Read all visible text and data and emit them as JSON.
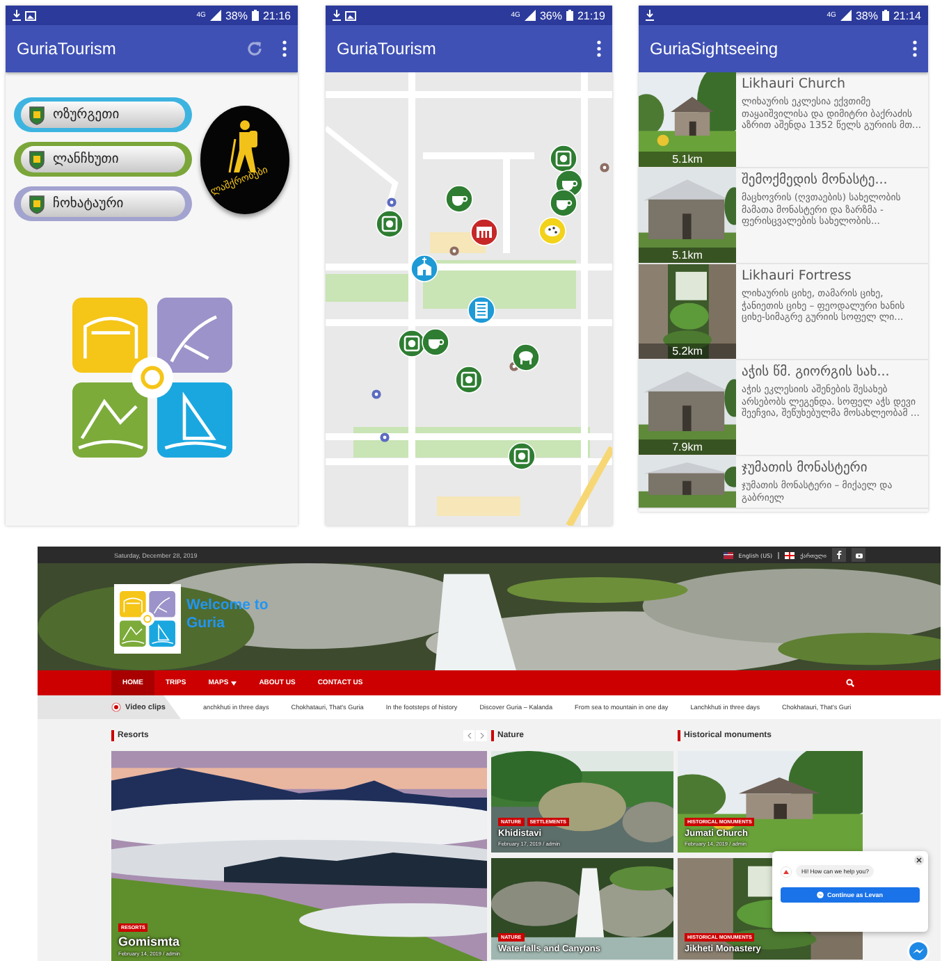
{
  "home_screen": {
    "status_bar": {
      "network": "4G",
      "battery": "38%",
      "time": "21:16"
    },
    "title": "GuriaTourism",
    "city_buttons": [
      {
        "label": "ოზურგეთი",
        "color": "#3db4e0"
      },
      {
        "label": "ლანჩხუთი",
        "color": "#7ba63a"
      },
      {
        "label": "ჩოხატაური",
        "color": "#a3a3d0"
      }
    ],
    "hiking_badge": {
      "label": "ლაშქრობები"
    }
  },
  "map_screen": {
    "status_bar": {
      "network": "4G",
      "battery": "36%",
      "time": "21:19"
    },
    "title": "GuriaTourism",
    "markers": [
      {
        "kind": "restaurant"
      },
      {
        "kind": "cafe"
      },
      {
        "kind": "cafe"
      },
      {
        "kind": "cafe"
      },
      {
        "kind": "restaurant"
      },
      {
        "kind": "theater"
      },
      {
        "kind": "art"
      },
      {
        "kind": "church"
      },
      {
        "kind": "bank"
      },
      {
        "kind": "restaurant"
      },
      {
        "kind": "cafe"
      },
      {
        "kind": "animal"
      },
      {
        "kind": "restaurant"
      },
      {
        "kind": "restaurant"
      }
    ]
  },
  "list_screen": {
    "status_bar": {
      "network": "4G",
      "battery": "38%",
      "time": "21:14"
    },
    "title": "GuriaSightseeing",
    "items": [
      {
        "title": "Likhauri Church",
        "description": "ლიხაურის ეკლესია ექვთიმე თაყაიშვილისა და დიმიტრი ბაქრაძის აზრით აშენდა 1352 წელს გურიის მთ...",
        "distance": "5.1km"
      },
      {
        "title": "შემოქმედის მონასტე...",
        "description": "მაცხოვრის (ღვთაების) სახელობის მამათა მონასტერი და ზარზმა - ფერისცვალების სახელობის...",
        "distance": "5.1km"
      },
      {
        "title": "Likhauri Fortress",
        "description": "ლიხაურის ციხე, თამარის ციხე, ჭანიეთის ციხე – ფეოდალური ხანის ციხე-სიმაგრე გურიის სოფელ ლი...",
        "distance": "5.2km"
      },
      {
        "title": "აჭის წმ. გიორგის სახ...",
        "description": "აჭის ეკლესიის აშენების შესახებ არსებობს ლეგენდა. სოფელ აჭს დევი შეეჩვია, შეწუხებულმა მოსახლეობამ ...",
        "distance": "7.9km"
      },
      {
        "title": "ჯუმათის მონასტერი",
        "description": "ჯუმათის მონასტერი – მიქაელ და გაბრიელ"
      }
    ]
  },
  "website": {
    "top_bar": {
      "date": "Saturday, December 28, 2019",
      "languages": [
        "English (US)",
        "ქართული"
      ]
    },
    "header": {
      "title": "Welcome to Guria"
    },
    "nav": [
      {
        "label": "HOME",
        "selected": true,
        "dropdown": false
      },
      {
        "label": "TRIPS",
        "selected": false,
        "dropdown": false
      },
      {
        "label": "MAPS",
        "selected": false,
        "dropdown": true
      },
      {
        "label": "ABOUT US",
        "selected": false,
        "dropdown": false
      },
      {
        "label": "CONTACT US",
        "selected": false,
        "dropdown": false
      }
    ],
    "ticker": {
      "label": "Video clips",
      "items": [
        "anchkhuti in three days",
        "Chokhatauri, That's Guria",
        "In the footsteps of history",
        "Discover Guria – Kalanda",
        "From sea to mountain in one day",
        "Lanchkhuti in three days",
        "Chokhatauri, That's Guri"
      ]
    },
    "sections": [
      {
        "title": "Resorts",
        "kind": "carousel"
      },
      {
        "title": "Nature",
        "kind": "grid"
      },
      {
        "title": "Historical monuments",
        "kind": "grid"
      }
    ],
    "resort_card": {
      "tags": [
        "RESORTS"
      ],
      "title": "Gomismta",
      "meta": "February 14, 2019 / admin"
    },
    "nature_cards": [
      {
        "tags": [
          "NATURE",
          "SETTLEMENTS"
        ],
        "title": "Khidistavi",
        "meta": "February 17, 2019 / admin"
      },
      {
        "tags": [
          "NATURE"
        ],
        "title": "Waterfalls and Canyons"
      }
    ],
    "history_cards": [
      {
        "tags": [
          "HISTORICAL MONUMENTS"
        ],
        "title": "Jumati Church",
        "meta": "February 14, 2019 / admin"
      },
      {
        "tags": [
          "HISTORICAL MONUMENTS"
        ],
        "title": "Jikheti Monastery"
      }
    ],
    "chat": {
      "message": "Hi! How can we help you?",
      "button": "Continue as Levan"
    }
  }
}
